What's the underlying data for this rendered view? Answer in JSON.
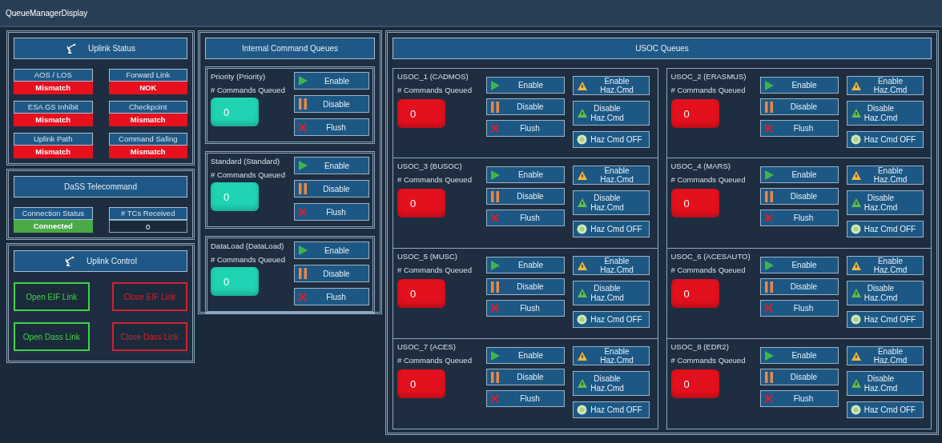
{
  "window": {
    "title": "QueueManagerDisplay"
  },
  "uplink_status": {
    "title": "Uplink Status",
    "fields": [
      {
        "label": "AOS / LOS",
        "value": "Mismatch",
        "kind": "bad"
      },
      {
        "label": "Forward Link",
        "value": "NOK",
        "kind": "bad"
      },
      {
        "label": "ESA GS Inhibit",
        "value": "Mismatch",
        "kind": "bad"
      },
      {
        "label": "Checkpoint",
        "value": "Mismatch",
        "kind": "bad"
      },
      {
        "label": "Uplink Path",
        "value": "Mismatch",
        "kind": "bad"
      },
      {
        "label": "Command Safing",
        "value": "Mismatch",
        "kind": "bad"
      }
    ]
  },
  "dass_telecommand": {
    "title": "DaSS Telecommand",
    "fields": [
      {
        "label": "Connection Status",
        "value": "Connected",
        "kind": "good"
      },
      {
        "label": "# TCs Received",
        "value": "0",
        "kind": "plain"
      }
    ]
  },
  "uplink_control": {
    "title": "Uplink Control",
    "buttons": [
      {
        "label": "Open EIF Link",
        "kind": "open"
      },
      {
        "label": "Close EIF Link",
        "kind": "close"
      },
      {
        "label": "Open Dass Link",
        "kind": "open"
      },
      {
        "label": "Close Dass Link",
        "kind": "close"
      }
    ]
  },
  "internal_command_queues": {
    "title": "Internal Command Queues",
    "queues": [
      {
        "name": "Priority (Priority)",
        "count_label": "# Commands Queued",
        "count": "0",
        "alert": false,
        "buttons": [
          {
            "label": "Enable",
            "kind": "enable"
          },
          {
            "label": "Disable",
            "kind": "disable"
          },
          {
            "label": "Flush",
            "kind": "flush"
          }
        ]
      },
      {
        "name": "Standard (Standard)",
        "count_label": "# Commands Queued",
        "count": "0",
        "alert": false,
        "buttons": [
          {
            "label": "Enable",
            "kind": "enable"
          },
          {
            "label": "Disable",
            "kind": "disable"
          },
          {
            "label": "Flush",
            "kind": "flush"
          }
        ]
      },
      {
        "name": "DataLoad (DataLoad)",
        "count_label": "# Commands Queued",
        "count": "0",
        "alert": false,
        "buttons": [
          {
            "label": "Enable",
            "kind": "enable"
          },
          {
            "label": "Disable",
            "kind": "disable"
          },
          {
            "label": "Flush",
            "kind": "flush"
          }
        ]
      }
    ]
  },
  "usoc_queues": {
    "title": "USOC Queues",
    "queues": [
      {
        "name": "USOC_1 (CADMOS)",
        "count_label": "# Commands Queued",
        "count": "0",
        "alert": true,
        "buttons": [
          {
            "label": "Enable",
            "kind": "enable"
          },
          {
            "label": "Disable",
            "kind": "disable"
          },
          {
            "label": "Flush",
            "kind": "flush"
          }
        ],
        "haz_buttons": [
          {
            "label": "Enable Haz.Cmd",
            "kind": "haz_enable"
          },
          {
            "label": "Disable Haz.Cmd",
            "kind": "haz_disable"
          },
          {
            "label": "Haz Cmd OFF",
            "kind": "haz_off"
          }
        ]
      },
      {
        "name": "USOC_2 (ERASMUS)",
        "count_label": "# Commands Queued",
        "count": "0",
        "alert": true,
        "buttons": [
          {
            "label": "Enable",
            "kind": "enable"
          },
          {
            "label": "Disable",
            "kind": "disable"
          },
          {
            "label": "Flush",
            "kind": "flush"
          }
        ],
        "haz_buttons": [
          {
            "label": "Enable Haz.Cmd",
            "kind": "haz_enable"
          },
          {
            "label": "Disable Haz.Cmd",
            "kind": "haz_disable"
          },
          {
            "label": "Haz Cmd OFF",
            "kind": "haz_off"
          }
        ]
      },
      {
        "name": "USOC_3 (BUSOC)",
        "count_label": "# Commands Queued",
        "count": "0",
        "alert": true,
        "buttons": [
          {
            "label": "Enable",
            "kind": "enable"
          },
          {
            "label": "Disable",
            "kind": "disable"
          },
          {
            "label": "Flush",
            "kind": "flush"
          }
        ],
        "haz_buttons": [
          {
            "label": "Enable Haz.Cmd",
            "kind": "haz_enable"
          },
          {
            "label": "Disable Haz.Cmd",
            "kind": "haz_disable"
          },
          {
            "label": "Haz Cmd OFF",
            "kind": "haz_off"
          }
        ]
      },
      {
        "name": "USOC_4 (MARS)",
        "count_label": "# Commands Queued",
        "count": "0",
        "alert": true,
        "buttons": [
          {
            "label": "Enable",
            "kind": "enable"
          },
          {
            "label": "Disable",
            "kind": "disable"
          },
          {
            "label": "Flush",
            "kind": "flush"
          }
        ],
        "haz_buttons": [
          {
            "label": "Enable Haz.Cmd",
            "kind": "haz_enable"
          },
          {
            "label": "Disable Haz.Cmd",
            "kind": "haz_disable"
          },
          {
            "label": "Haz Cmd OFF",
            "kind": "haz_off"
          }
        ]
      },
      {
        "name": "USOC_5 (MUSC)",
        "count_label": "# Commands Queued",
        "count": "0",
        "alert": true,
        "buttons": [
          {
            "label": "Enable",
            "kind": "enable"
          },
          {
            "label": "Disable",
            "kind": "disable"
          },
          {
            "label": "Flush",
            "kind": "flush"
          }
        ],
        "haz_buttons": [
          {
            "label": "Enable Haz.Cmd",
            "kind": "haz_enable"
          },
          {
            "label": "Disable Haz.Cmd",
            "kind": "haz_disable"
          },
          {
            "label": "Haz Cmd OFF",
            "kind": "haz_off"
          }
        ]
      },
      {
        "name": "USOC_6 (ACESAUTO)",
        "count_label": "# Commands Queued",
        "count": "0",
        "alert": true,
        "buttons": [
          {
            "label": "Enable",
            "kind": "enable"
          },
          {
            "label": "Disable",
            "kind": "disable"
          },
          {
            "label": "Flush",
            "kind": "flush"
          }
        ],
        "haz_buttons": [
          {
            "label": "Enable Haz.Cmd",
            "kind": "haz_enable"
          },
          {
            "label": "Disable Haz.Cmd",
            "kind": "haz_disable"
          },
          {
            "label": "Haz Cmd OFF",
            "kind": "haz_off"
          }
        ]
      },
      {
        "name": "USOC_7 (ACES)",
        "count_label": "# Commands Queued",
        "count": "0",
        "alert": true,
        "buttons": [
          {
            "label": "Enable",
            "kind": "enable"
          },
          {
            "label": "Disable",
            "kind": "disable"
          },
          {
            "label": "Flush",
            "kind": "flush"
          }
        ],
        "haz_buttons": [
          {
            "label": "Enable Haz.Cmd",
            "kind": "haz_enable"
          },
          {
            "label": "Disable Haz.Cmd",
            "kind": "haz_disable"
          },
          {
            "label": "Haz Cmd OFF",
            "kind": "haz_off"
          }
        ]
      },
      {
        "name": "USOC_8 (EDR2)",
        "count_label": "# Commands Queued",
        "count": "0",
        "alert": true,
        "buttons": [
          {
            "label": "Enable",
            "kind": "enable"
          },
          {
            "label": "Disable",
            "kind": "disable"
          },
          {
            "label": "Flush",
            "kind": "flush"
          }
        ],
        "haz_buttons": [
          {
            "label": "Enable Haz.Cmd",
            "kind": "haz_enable"
          },
          {
            "label": "Disable Haz.Cmd",
            "kind": "haz_disable"
          },
          {
            "label": "Haz Cmd OFF",
            "kind": "haz_off"
          }
        ]
      }
    ]
  }
}
